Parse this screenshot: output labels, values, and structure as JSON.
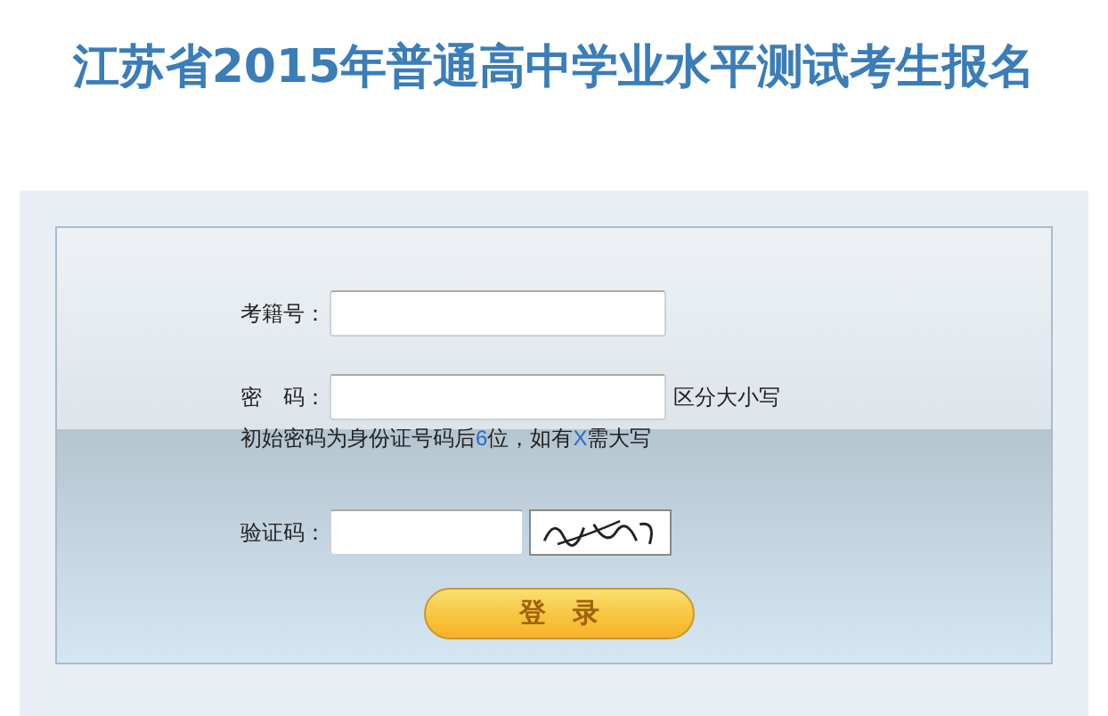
{
  "title": "江苏省2015年普通高中学业水平测试考生报名",
  "form": {
    "exam_number": {
      "label": "考籍号："
    },
    "password": {
      "label": "密　码：",
      "note": "区分大小写",
      "hint": [
        {
          "text": "初始密码为身份证号码后",
          "highlight": false
        },
        {
          "text": "6",
          "highlight": true
        },
        {
          "text": "位，如有",
          "highlight": false
        },
        {
          "text": "X",
          "highlight": true
        },
        {
          "text": "需大写",
          "highlight": false
        }
      ]
    },
    "captcha": {
      "label": "验证码："
    },
    "submit": "登　录"
  }
}
